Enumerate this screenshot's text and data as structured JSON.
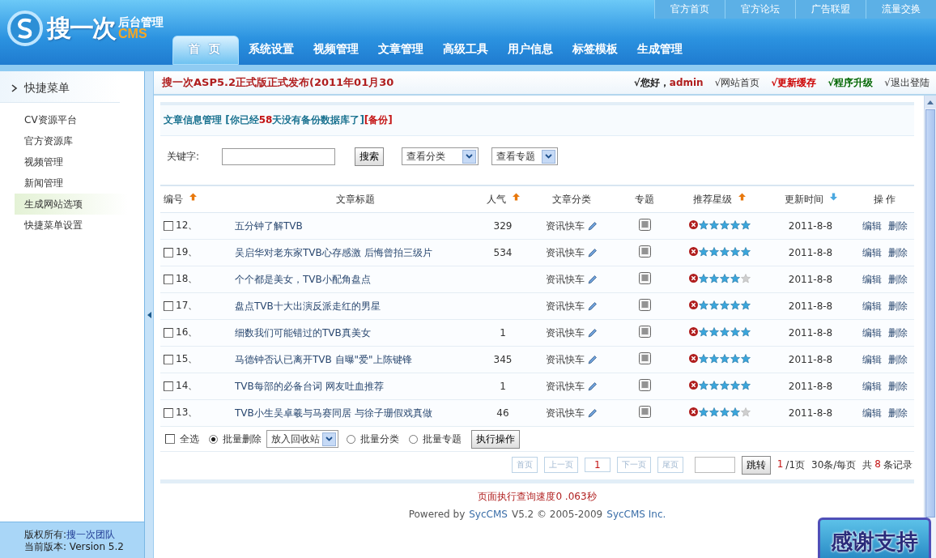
{
  "logo": {
    "name": "搜一次",
    "subtitle": "后台管理",
    "product": "CMS"
  },
  "top_links": [
    "官方首页",
    "官方论坛",
    "广告联盟",
    "流量交换"
  ],
  "nav_tabs": [
    {
      "label": "首 页",
      "selected": true
    },
    {
      "label": "系统设置",
      "selected": false
    },
    {
      "label": "视频管理",
      "selected": false
    },
    {
      "label": "文章管理",
      "selected": false
    },
    {
      "label": "高级工具",
      "selected": false
    },
    {
      "label": "用户信息",
      "selected": false
    },
    {
      "label": "标签模板",
      "selected": false
    },
    {
      "label": "生成管理",
      "selected": false
    }
  ],
  "sidebar": {
    "title": "快捷菜单",
    "items": [
      {
        "label": "CV资源平台",
        "selected": false
      },
      {
        "label": "官方资源库",
        "selected": false
      },
      {
        "label": "视频管理",
        "selected": false
      },
      {
        "label": "新闻管理",
        "selected": false
      },
      {
        "label": "生成网站选项",
        "selected": true
      },
      {
        "label": "快捷菜单设置",
        "selected": false
      }
    ],
    "copyright_label": "版权所有:",
    "copyright_link": "搜一次团队",
    "version": "当前版本: Version 5.2"
  },
  "announcement": "搜一次ASP5.2正式版正式发布(2011年01月30",
  "greeting": {
    "prefix": "√您好，",
    "user": "admin"
  },
  "quick_links": [
    {
      "label": "√网站首页",
      "kind": "normal"
    },
    {
      "label": "√更新缓存",
      "kind": "alert"
    },
    {
      "label": "√程序升级",
      "kind": "success"
    },
    {
      "label": "√退出登陆",
      "kind": "normal"
    }
  ],
  "panel_heading": [
    {
      "kind": "title",
      "text": "文章信息管理 [你已经"
    },
    {
      "kind": "alert",
      "text": "58"
    },
    {
      "kind": "title",
      "text": "天没有备份数据库了]"
    },
    {
      "kind": "link",
      "text": "[备份]"
    }
  ],
  "search": {
    "label": "关键字:",
    "button": "搜索",
    "selects": [
      "查看分类",
      "查看专题"
    ]
  },
  "table": {
    "columns": [
      {
        "label": "编号",
        "sortable": true,
        "descending": false
      },
      {
        "label": "文章标题",
        "sortable": false
      },
      {
        "label": "人气",
        "sortable": true,
        "descending": false
      },
      {
        "label": "文章分类",
        "sortable": false
      },
      {
        "label": "专题",
        "sortable": false
      },
      {
        "label": "推荐星级",
        "sortable": true,
        "descending": false
      },
      {
        "label": "更新时间",
        "sortable": true,
        "descending": true
      },
      {
        "label": "操 作",
        "sortable": false
      }
    ],
    "rows": [
      {
        "checked": false,
        "id": "12、",
        "title": "五分钟了解TVB",
        "popularity": "329",
        "category": "资讯快车",
        "stars": 5,
        "date": "2011-8-8",
        "actions": [
          "编辑",
          "删除"
        ]
      },
      {
        "checked": false,
        "id": "19、",
        "title": "吴启华对老东家TVB心存感激 后悔曾拍三级片",
        "popularity": "534",
        "category": "资讯快车",
        "stars": 5,
        "date": "2011-8-8",
        "actions": [
          "编辑",
          "删除"
        ]
      },
      {
        "checked": false,
        "id": "18、",
        "title": "个个都是美女，TVB小配角盘点",
        "category": "资讯快车",
        "stars": 4,
        "date": "2011-8-8",
        "actions": [
          "编辑",
          "删除"
        ]
      },
      {
        "checked": false,
        "id": "17、",
        "title": "盘点TVB十大出演反派走红的男星",
        "category": "资讯快车",
        "stars": 5,
        "date": "2011-8-8",
        "actions": [
          "编辑",
          "删除"
        ]
      },
      {
        "checked": false,
        "id": "16、",
        "title": "细数我们可能错过的TVB真美女",
        "popularity": "1",
        "category": "资讯快车",
        "stars": 5,
        "date": "2011-8-8",
        "actions": [
          "编辑",
          "删除"
        ]
      },
      {
        "checked": false,
        "id": "15、",
        "title": "马德钟否认已离开TVB 自曝\"爱\"上陈键锋",
        "popularity": "345",
        "category": "资讯快车",
        "stars": 5,
        "date": "2011-8-8",
        "actions": [
          "编辑",
          "删除"
        ]
      },
      {
        "checked": false,
        "id": "14、",
        "title": "TVB每部的必备台词 网友吐血推荐",
        "popularity": "1",
        "category": "资讯快车",
        "stars": 5,
        "date": "2011-8-8",
        "actions": [
          "编辑",
          "删除"
        ]
      },
      {
        "checked": false,
        "id": "13、",
        "title": "TVB小生吴卓羲与马赛同居 与徐子珊假戏真做",
        "popularity": "46",
        "category": "资讯快车",
        "stars": 4,
        "date": "2011-8-8",
        "actions": [
          "编辑",
          "删除"
        ]
      }
    ]
  },
  "batch": {
    "select_all": {
      "label": "全选",
      "checked": false
    },
    "options": [
      {
        "label": "批量删除",
        "selected": true
      },
      {
        "label": "批量分类",
        "selected": false
      },
      {
        "label": "批量专题",
        "selected": false
      }
    ],
    "target": "放入回收站",
    "button": "执行操作"
  },
  "pagination": {
    "pages": [
      {
        "label": "首页",
        "kind": "nav"
      },
      {
        "label": "上一页",
        "kind": "nav"
      },
      {
        "label": "1",
        "kind": "current"
      },
      {
        "label": "下一页",
        "kind": "nav"
      },
      {
        "label": "尾页",
        "kind": "nav"
      }
    ],
    "jump": "跳转",
    "current": "1",
    "total": "/1页",
    "per_page": "30条/每页",
    "count_prefix": "共",
    "count": "8",
    "count_suffix": "条记录"
  },
  "speed": "页面执行查询速度0 .063秒",
  "powered": [
    {
      "kind": "text",
      "text": "Powered by"
    },
    {
      "kind": "link",
      "text": "SycCMS"
    },
    {
      "kind": "text",
      "text": "V5.2 © 2005-2009"
    },
    {
      "kind": "link",
      "text": "SycCMS Inc."
    }
  ],
  "badge": "感谢支持"
}
